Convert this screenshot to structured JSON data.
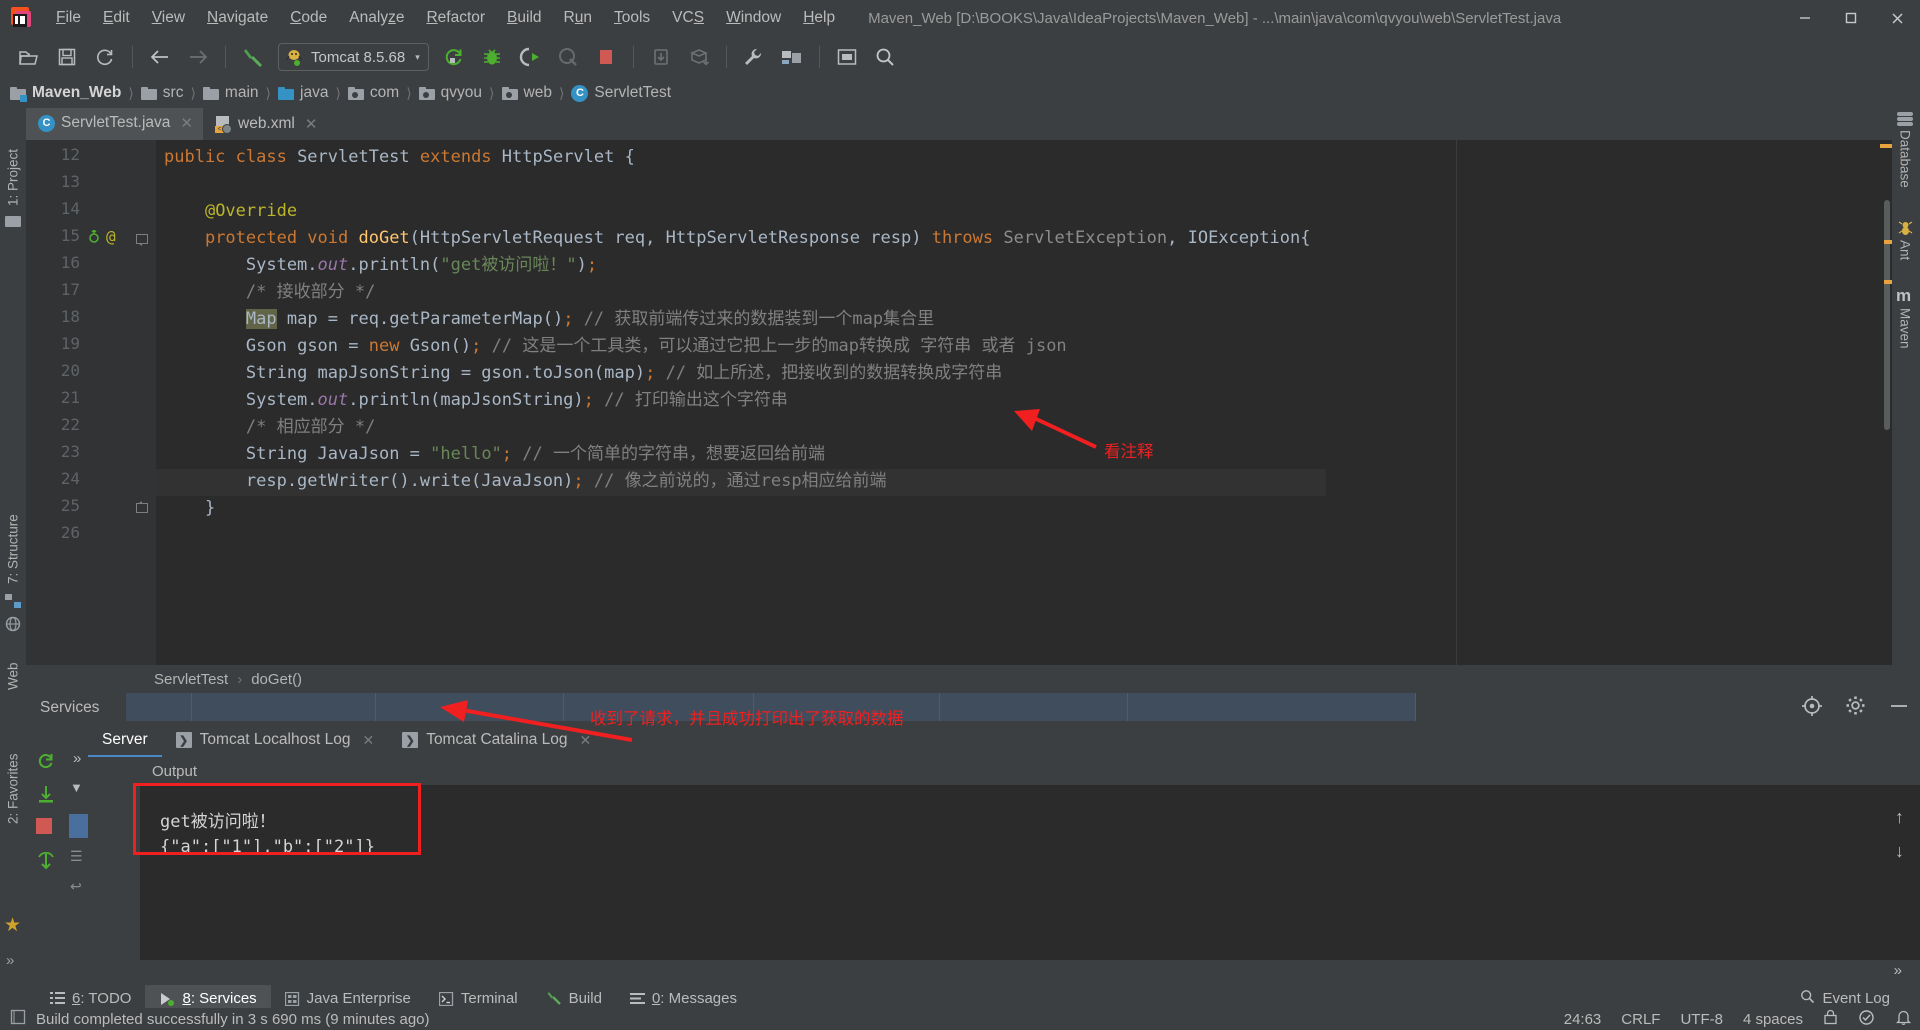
{
  "window": {
    "title": "Maven_Web [D:\\BOOKS\\Java\\IdeaProjects\\Maven_Web] - ...\\main\\java\\com\\qvyou\\web\\ServletTest.java",
    "minimize_label": "–",
    "maximize_label": "❐",
    "close_label": "✕"
  },
  "menu": [
    {
      "label": "File"
    },
    {
      "label": "Edit"
    },
    {
      "label": "View"
    },
    {
      "label": "Navigate"
    },
    {
      "label": "Code"
    },
    {
      "label": "Analyze"
    },
    {
      "label": "Refactor"
    },
    {
      "label": "Build"
    },
    {
      "label": "Run"
    },
    {
      "label": "Tools"
    },
    {
      "label": "VCS"
    },
    {
      "label": "Window"
    },
    {
      "label": "Help"
    }
  ],
  "toolbar": {
    "run_config": "Tomcat 8.5.68",
    "dropdown_arrow": "▾",
    "icons": [
      "open-folder-icon",
      "save-icon",
      "sync-icon",
      "back-arrow-icon",
      "forward-arrow-icon",
      "build-hammer-icon",
      "rerun-icon",
      "debug-icon",
      "run-with-coverage-icon",
      "profile-icon",
      "stop-icon",
      "update-app-icon",
      "redeploy-icon",
      "settings-wrench-icon",
      "project-structure-icon",
      "select-opened-file-icon",
      "search-everywhere-icon"
    ]
  },
  "breadcrumbs": [
    {
      "label": "Maven_Web",
      "icon": "module-folder-icon"
    },
    {
      "label": "src",
      "icon": "folder-icon"
    },
    {
      "label": "main",
      "icon": "folder-icon"
    },
    {
      "label": "java",
      "icon": "source-root-folder-icon"
    },
    {
      "label": "com",
      "icon": "package-icon"
    },
    {
      "label": "qvyou",
      "icon": "package-icon"
    },
    {
      "label": "web",
      "icon": "package-icon"
    },
    {
      "label": "ServletTest",
      "icon": "class-icon"
    }
  ],
  "editor_tabs": [
    {
      "label": "ServletTest.java",
      "icon": "java-class-icon",
      "active": true,
      "close": "✕"
    },
    {
      "label": "web.xml",
      "icon": "xml-file-icon",
      "active": false,
      "close": "✕"
    }
  ],
  "left_tool_strip": [
    {
      "label": "1: Project"
    },
    {
      "label": "7: Structure"
    },
    {
      "label": "Web"
    },
    {
      "label": "2: Favorites"
    }
  ],
  "right_tool_strip": [
    {
      "label": "Database"
    },
    {
      "label": "Ant"
    },
    {
      "label": "Maven"
    }
  ],
  "code": {
    "first_line_number": 12,
    "lines": [
      {
        "n": 12,
        "text": "public class ServletTest extends HttpServlet {"
      },
      {
        "n": 13,
        "text": ""
      },
      {
        "n": 14,
        "text": "    @Override"
      },
      {
        "n": 15,
        "text": "    protected void doGet(HttpServletRequest req, HttpServletResponse resp) throws ServletException, IOException{"
      },
      {
        "n": 16,
        "text": "        System.out.println(\"get被访问啦！\");"
      },
      {
        "n": 17,
        "text": "        /* 接收部分 */"
      },
      {
        "n": 18,
        "text": "        Map map = req.getParameterMap(); // 获取前端传过来的数据装到一个map集合里"
      },
      {
        "n": 19,
        "text": "        Gson gson = new Gson(); // 这是一个工具类，可以通过它把上一步的map转换成 字符串 或者 json"
      },
      {
        "n": 20,
        "text": "        String mapJsonString = gson.toJson(map); // 如上所述，把接收到的数据转换成字符串"
      },
      {
        "n": 21,
        "text": "        System.out.println(mapJsonString); // 打印输出这个字符串"
      },
      {
        "n": 22,
        "text": "        /* 相应部分 */"
      },
      {
        "n": 23,
        "text": "        String JavaJson = \"hello\"; // 一个简单的字符串，想要返回给前端"
      },
      {
        "n": 24,
        "text": "        resp.getWriter().write(JavaJson); // 像之前说的，通过resp相应给前端"
      },
      {
        "n": 25,
        "text": "    }"
      },
      {
        "n": 26,
        "text": ""
      }
    ]
  },
  "method_path": {
    "class": "ServletTest",
    "separator": "›",
    "method": "doGet()"
  },
  "services": {
    "panel_title": "Services",
    "tabs": [
      {
        "label": "Server",
        "active": true,
        "closable": false
      },
      {
        "label": "Tomcat Localhost Log",
        "active": false,
        "closable": true,
        "close": "✕",
        "icon": "log-icon"
      },
      {
        "label": "Tomcat Catalina Log",
        "active": false,
        "closable": true,
        "close": "✕",
        "icon": "log-icon"
      }
    ],
    "output_label": "Output",
    "output_lines": [
      "get被访问啦！",
      "{\"a\":[\"1\"],\"b\":[\"2\"]}"
    ],
    "actions": [
      "locate-icon",
      "settings-gear-icon",
      "hide-icon"
    ]
  },
  "annotations": [
    {
      "id": "code-note",
      "text": "看注释",
      "color": "#f02020"
    },
    {
      "id": "output-note",
      "text": "收到了请求，并且成功打印出了获取的数据",
      "color": "#f02020"
    }
  ],
  "bottom_tool_windows": [
    {
      "label": "6: TODO",
      "icon": "todo-icon",
      "active": false
    },
    {
      "label": "8: Services",
      "icon": "services-icon",
      "active": true
    },
    {
      "label": "Java Enterprise",
      "icon": "java-ee-icon",
      "active": false
    },
    {
      "label": "Terminal",
      "icon": "terminal-icon",
      "active": false
    },
    {
      "label": "Build",
      "icon": "build-icon",
      "active": false
    },
    {
      "label": "0: Messages",
      "icon": "messages-icon",
      "active": false
    }
  ],
  "status_bar": {
    "message": "Build completed successfully in 3 s 690 ms (9 minutes ago)",
    "caret": "24:63",
    "line_sep": "CRLF",
    "encoding": "UTF-8",
    "indent": "4 spaces",
    "event_log": "Event Log",
    "lock_icon": "lock-icon",
    "inspection_icon": "inspection-icon",
    "notification_icon": "notification-icon"
  },
  "colors": {
    "accent_blue": "#3592c4",
    "annotation_red": "#f02020",
    "editor_bg": "#2b2b2b",
    "chrome_bg": "#3c3f41",
    "keyword_orange": "#cc7832",
    "string_green": "#6a8759",
    "comment_gray": "#808080",
    "annotation_yellow": "#bbb529",
    "method_yellow": "#ffc66d"
  }
}
